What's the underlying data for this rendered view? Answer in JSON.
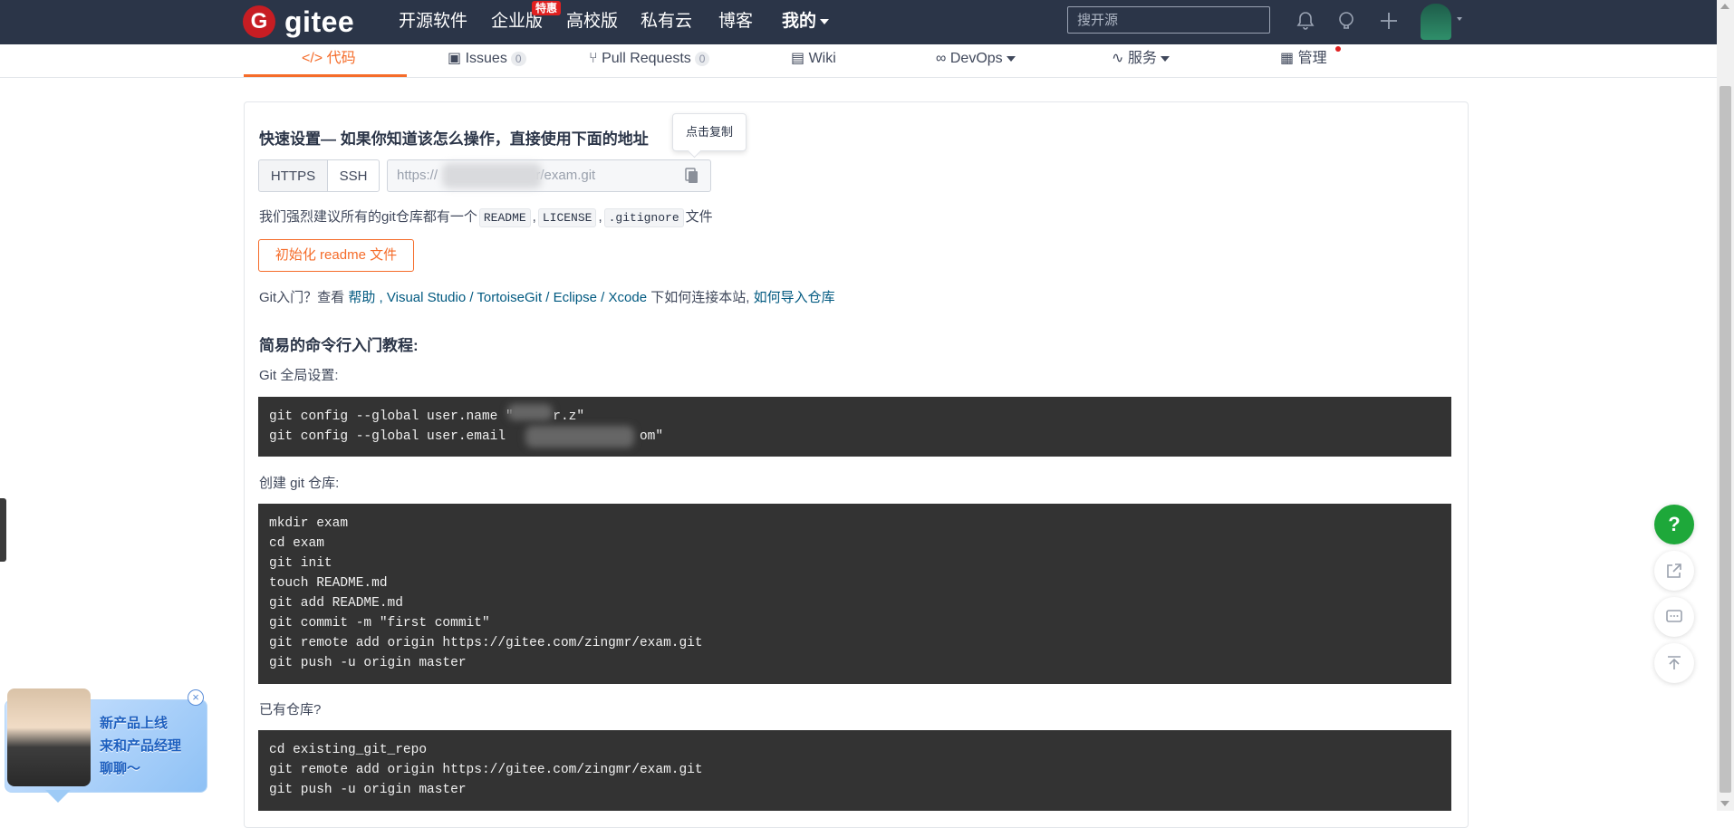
{
  "nav": {
    "logo_mark": "G",
    "logo_text": "gitee",
    "links": [
      "开源软件",
      "企业版",
      "高校版",
      "私有云",
      "博客",
      "我的"
    ],
    "hot_badge": "特惠",
    "search_placeholder": "搜开源"
  },
  "tabs": {
    "code": "代码",
    "issues": "Issues",
    "issues_count": "0",
    "pulls": "Pull Requests",
    "pulls_count": "0",
    "wiki": "Wiki",
    "devops": "DevOps",
    "services": "服务",
    "manage": "管理"
  },
  "quick": {
    "title": "快速设置— 如果你知道该怎么操作，直接使用下面的地址",
    "tooltip": "点击复制",
    "https": "HTTPS",
    "ssh": "SSH",
    "url_prefix": "https://",
    "url_suffix": "nr/exam.git",
    "recommend_prefix": "我们强烈建议所有的git仓库都有一个",
    "readme": "README",
    "license": "LICENSE",
    "gitignore": ".gitignore",
    "recommend_suffix": "文件",
    "init_button": "初始化 readme 文件"
  },
  "help": {
    "prefix": "Git入门？查看",
    "help_link": "帮助",
    "vs": "Visual Studio",
    "tortoise": "TortoiseGit",
    "eclipse": "Eclipse",
    "xcode": "Xcode",
    "middle": "下如何连接本站,",
    "import_link": "如何导入仓库"
  },
  "tutorial": {
    "title": "简易的命令行入门教程:",
    "global_label": "Git 全局设置:",
    "global_code": "git config --global user.name \"     r.z\"\ngit config --global user.email                 om\"",
    "create_label": "创建 git 仓库:",
    "create_code": "mkdir exam\ncd exam\ngit init\ntouch README.md\ngit add README.md\ngit commit -m \"first commit\"\ngit remote add origin https://gitee.com/zingmr/exam.git\ngit push -u origin master",
    "existing_label": "已有仓库?",
    "existing_code": "cd existing_git_repo\ngit remote add origin https://gitee.com/zingmr/exam.git\ngit push -u origin master"
  },
  "promo": {
    "line1": "新产品上线",
    "line2": "来和产品经理",
    "line3": "聊聊～",
    "close": "×"
  },
  "fab": {
    "help": "?"
  },
  "colors": {
    "accent": "#f56c2a",
    "nav_bg": "#2b3548",
    "code_bg": "#333333",
    "link": "#005980",
    "help_green": "#1ea83a"
  }
}
